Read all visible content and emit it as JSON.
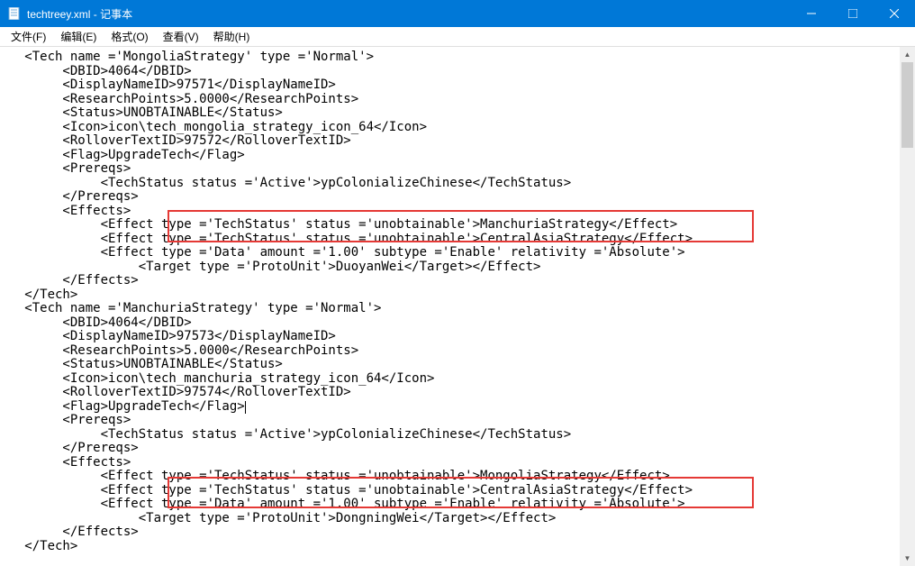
{
  "window": {
    "title": "techtreey.xml - 记事本",
    "icon_name": "notepad-icon"
  },
  "menu": {
    "file": "文件(F)",
    "edit": "编辑(E)",
    "format": "格式(O)",
    "view": "查看(V)",
    "help": "帮助(H)"
  },
  "editor": {
    "lines": [
      "   <Tech name ='MongoliaStrategy' type ='Normal'>",
      "        <DBID>4064</DBID>",
      "        <DisplayNameID>97571</DisplayNameID>",
      "        <ResearchPoints>5.0000</ResearchPoints>",
      "        <Status>UNOBTAINABLE</Status>",
      "        <Icon>icon\\tech_mongolia_strategy_icon_64</Icon>",
      "        <RolloverTextID>97572</RolloverTextID>",
      "        <Flag>UpgradeTech</Flag>",
      "        <Prereqs>",
      "             <TechStatus status ='Active'>ypColonializeChinese</TechStatus>",
      "        </Prereqs>",
      "        <Effects>",
      "             <Effect type ='TechStatus' status ='unobtainable'>ManchuriaStrategy</Effect>",
      "             <Effect type ='TechStatus' status ='unobtainable'>CentralAsiaStrategy</Effect>",
      "             <Effect type ='Data' amount ='1.00' subtype ='Enable' relativity ='Absolute'>",
      "                  <Target type ='ProtoUnit'>DuoyanWei</Target></Effect>",
      "        </Effects>",
      "   </Tech>",
      "   <Tech name ='ManchuriaStrategy' type ='Normal'>",
      "        <DBID>4064</DBID>",
      "        <DisplayNameID>97573</DisplayNameID>",
      "        <ResearchPoints>5.0000</ResearchPoints>",
      "        <Status>UNOBTAINABLE</Status>",
      "        <Icon>icon\\tech_manchuria_strategy_icon_64</Icon>",
      "        <RolloverTextID>97574</RolloverTextID>",
      "        <Flag>UpgradeTech</Flag>",
      "        <Prereqs>",
      "             <TechStatus status ='Active'>ypColonializeChinese</TechStatus>",
      "        </Prereqs>",
      "        <Effects>",
      "             <Effect type ='TechStatus' status ='unobtainable'>MongoliaStrategy</Effect>",
      "             <Effect type ='TechStatus' status ='unobtainable'>CentralAsiaStrategy</Effect>",
      "             <Effect type ='Data' amount ='1.00' subtype ='Enable' relativity ='Absolute'>",
      "                  <Target type ='ProtoUnit'>DongningWei</Target></Effect>",
      "        </Effects>",
      "   </Tech>"
    ],
    "cursor_line": 25
  }
}
